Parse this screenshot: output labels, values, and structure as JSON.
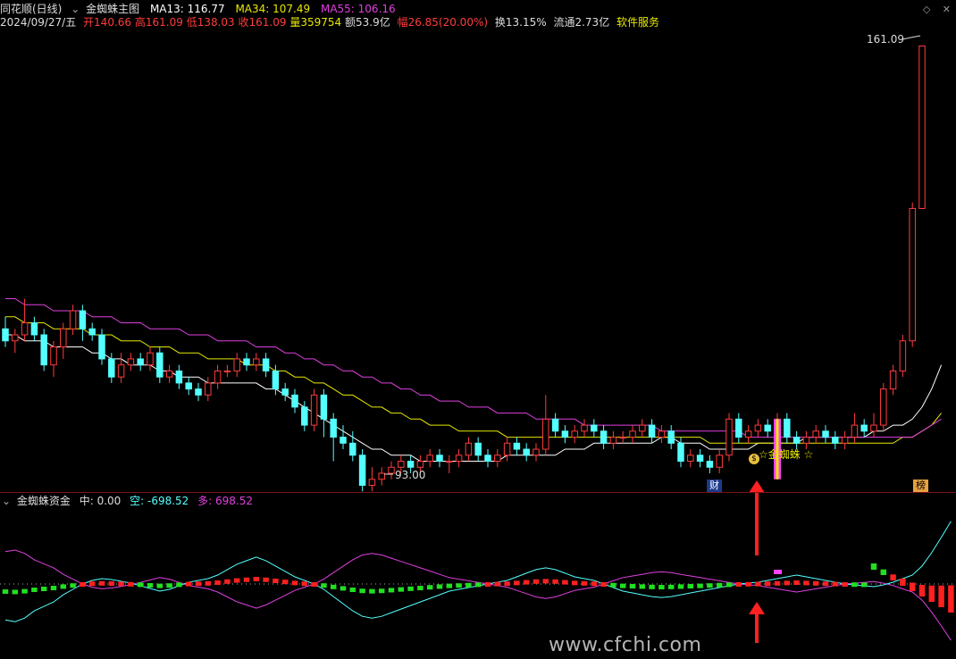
{
  "header": {
    "app": "同花顺(日线)",
    "indicator": "金蜘蛛主图",
    "ma13": "MA13: 116.77",
    "ma34": "MA34: 107.49",
    "ma55": "MA55: 106.16",
    "date": "2024/09/27/五",
    "open": "开140.66",
    "high": "高161.09",
    "low": "低138.03",
    "close": "收161.09",
    "volume": "量359754",
    "amount": "额53.9亿",
    "change": "幅26.85(20.00%)",
    "turnover": "换13.15%",
    "float": "流通2.73亿",
    "sector": "软件服务"
  },
  "subpanel": {
    "title": "金蜘蛛资金",
    "mid": "中: 0.00",
    "short": "空: -698.52",
    "long": "多: 698.52"
  },
  "labels": {
    "high_price": "161.09",
    "low_price": "93.00",
    "signal": "☆金蜘蛛 ☆",
    "signal_badge": "$",
    "marker_cai": "财",
    "marker_bang": "榜"
  },
  "watermark": "www.cfchi.com",
  "colors": {
    "up": "#ff3c3c",
    "down": "#54ffff",
    "ma13": "#ffffff",
    "ma34": "#e8e800",
    "ma55": "#e040e0",
    "arrow": "#ff2020",
    "grid": "#7a1414"
  },
  "chart_data": {
    "type": "candlestick",
    "price_range": [
      90,
      163
    ],
    "candles": [
      [
        114,
        112,
        116,
        111
      ],
      [
        112,
        113,
        114,
        110
      ],
      [
        113,
        115,
        119,
        112
      ],
      [
        115,
        113,
        116,
        112
      ],
      [
        113,
        108,
        114,
        107
      ],
      [
        108,
        111,
        112,
        106
      ],
      [
        111,
        114,
        115,
        109
      ],
      [
        114,
        117,
        118,
        113
      ],
      [
        117,
        114,
        118,
        112
      ],
      [
        114,
        113,
        115,
        112
      ],
      [
        113,
        109,
        114,
        108
      ],
      [
        109,
        106,
        110,
        105
      ],
      [
        106,
        108,
        110,
        105
      ],
      [
        108,
        109,
        110,
        107
      ],
      [
        109,
        108,
        110,
        107
      ],
      [
        108,
        110,
        111,
        107
      ],
      [
        110,
        106,
        111,
        105
      ],
      [
        106,
        107,
        108,
        105
      ],
      [
        107,
        105,
        108,
        104
      ],
      [
        105,
        104,
        106,
        103
      ],
      [
        104,
        103,
        105,
        102
      ],
      [
        103,
        105,
        106,
        102
      ],
      [
        105,
        107,
        108,
        104
      ],
      [
        107,
        107,
        108,
        106
      ],
      [
        107,
        109,
        110,
        106
      ],
      [
        109,
        108,
        110,
        107
      ],
      [
        108,
        109,
        110,
        107
      ],
      [
        109,
        107,
        110,
        106
      ],
      [
        107,
        104,
        108,
        103
      ],
      [
        104,
        103,
        105,
        102
      ],
      [
        103,
        101,
        104,
        100
      ],
      [
        101,
        98,
        102,
        97
      ],
      [
        98,
        103,
        104,
        97
      ],
      [
        103,
        99,
        104,
        96
      ],
      [
        99,
        96,
        100,
        92
      ],
      [
        96,
        95,
        98,
        94
      ],
      [
        95,
        93,
        97,
        92
      ],
      [
        93,
        88,
        94,
        87
      ],
      [
        88,
        89,
        91,
        87
      ],
      [
        89,
        90,
        91,
        88
      ],
      [
        90,
        91,
        92,
        89
      ],
      [
        91,
        92,
        93,
        90
      ],
      [
        92,
        91,
        93,
        90
      ],
      [
        91,
        92,
        93,
        90
      ],
      [
        92,
        93,
        94,
        91
      ],
      [
        93,
        92,
        94,
        91
      ],
      [
        92,
        92,
        93,
        90
      ],
      [
        92,
        93,
        94,
        91
      ],
      [
        93,
        95,
        96,
        92
      ],
      [
        95,
        93,
        96,
        92
      ],
      [
        93,
        92,
        94,
        91
      ],
      [
        92,
        93,
        94,
        91
      ],
      [
        93,
        95,
        96,
        92
      ],
      [
        95,
        94,
        96,
        93
      ],
      [
        94,
        93,
        95,
        92
      ],
      [
        93,
        94,
        95,
        92
      ],
      [
        94,
        99,
        103,
        93
      ],
      [
        99,
        97,
        100,
        96
      ],
      [
        97,
        96,
        98,
        95
      ],
      [
        96,
        97,
        98,
        95
      ],
      [
        97,
        98,
        99,
        96
      ],
      [
        98,
        97,
        99,
        96
      ],
      [
        97,
        95,
        98,
        94
      ],
      [
        95,
        96,
        97,
        94
      ],
      [
        96,
        96,
        97,
        95
      ],
      [
        96,
        97,
        98,
        95
      ],
      [
        97,
        98,
        99,
        96
      ],
      [
        98,
        96,
        99,
        95
      ],
      [
        96,
        97,
        98,
        95
      ],
      [
        97,
        95,
        98,
        94
      ],
      [
        95,
        92,
        96,
        91
      ],
      [
        92,
        93,
        94,
        91
      ],
      [
        93,
        92,
        94,
        91
      ],
      [
        92,
        91,
        93,
        90
      ],
      [
        91,
        93,
        94,
        90
      ],
      [
        93,
        99,
        100,
        92
      ],
      [
        99,
        96,
        100,
        95
      ],
      [
        96,
        97,
        98,
        95
      ],
      [
        97,
        98,
        99,
        96
      ],
      [
        98,
        97,
        99,
        96
      ],
      [
        97,
        99,
        100,
        96
      ],
      [
        99,
        96,
        100,
        95
      ],
      [
        96,
        95,
        97,
        94
      ],
      [
        95,
        96,
        97,
        94
      ],
      [
        96,
        97,
        98,
        95
      ],
      [
        97,
        96,
        98,
        95
      ],
      [
        96,
        95,
        97,
        94
      ],
      [
        95,
        96,
        97,
        94
      ],
      [
        96,
        98,
        100,
        95
      ],
      [
        98,
        97,
        99,
        96
      ],
      [
        97,
        98,
        100,
        96
      ],
      [
        98,
        104,
        105,
        97
      ],
      [
        104,
        107,
        108,
        103
      ],
      [
        107,
        112,
        113,
        106
      ],
      [
        112,
        134,
        135,
        111
      ],
      [
        134,
        161,
        161,
        138
      ]
    ],
    "ma13": [
      113,
      113,
      112,
      112,
      112,
      111,
      111,
      111,
      111,
      110,
      110,
      109,
      109,
      108,
      108,
      108,
      107,
      107,
      106,
      106,
      106,
      105,
      105,
      105,
      105,
      105,
      105,
      104,
      104,
      103,
      102,
      101,
      100,
      99,
      98,
      97,
      96,
      95,
      94,
      94,
      93,
      93,
      93,
      92,
      92,
      92,
      92,
      92,
      92,
      92,
      92,
      92,
      93,
      93,
      93,
      93,
      93,
      93,
      94,
      94,
      94,
      95,
      95,
      95,
      95,
      95,
      95,
      95,
      96,
      96,
      95,
      95,
      95,
      94,
      94,
      94,
      94,
      94,
      95,
      95,
      95,
      95,
      95,
      96,
      96,
      96,
      96,
      96,
      96,
      96,
      97,
      97,
      98,
      98,
      99,
      101,
      104,
      108
    ],
    "ma34": [
      116,
      116,
      115,
      115,
      115,
      114,
      114,
      114,
      114,
      113,
      113,
      113,
      112,
      112,
      112,
      111,
      111,
      111,
      110,
      110,
      110,
      109,
      109,
      109,
      109,
      108,
      108,
      108,
      107,
      107,
      106,
      106,
      105,
      105,
      104,
      103,
      103,
      102,
      101,
      101,
      100,
      100,
      99,
      99,
      98,
      98,
      98,
      97,
      97,
      97,
      97,
      97,
      96,
      96,
      96,
      96,
      96,
      96,
      96,
      96,
      96,
      96,
      96,
      96,
      96,
      96,
      96,
      96,
      96,
      96,
      96,
      96,
      96,
      95,
      95,
      95,
      95,
      95,
      95,
      95,
      95,
      95,
      95,
      95,
      95,
      95,
      95,
      95,
      95,
      95,
      95,
      95,
      95,
      96,
      96,
      97,
      98,
      100
    ],
    "ma55": [
      119,
      119,
      118,
      118,
      118,
      117,
      117,
      117,
      117,
      116,
      116,
      116,
      115,
      115,
      115,
      114,
      114,
      114,
      114,
      113,
      113,
      113,
      112,
      112,
      112,
      112,
      111,
      111,
      111,
      110,
      110,
      109,
      109,
      108,
      108,
      107,
      107,
      106,
      106,
      105,
      105,
      104,
      104,
      103,
      103,
      102,
      102,
      102,
      101,
      101,
      101,
      100,
      100,
      100,
      100,
      99,
      99,
      99,
      99,
      99,
      98,
      98,
      98,
      98,
      98,
      98,
      98,
      98,
      97,
      97,
      97,
      97,
      97,
      97,
      97,
      97,
      97,
      96,
      96,
      96,
      96,
      96,
      96,
      96,
      96,
      96,
      96,
      96,
      96,
      96,
      96,
      96,
      96,
      96,
      96,
      97,
      98,
      99
    ],
    "funds": [
      -400,
      -420,
      -380,
      -300,
      -250,
      -200,
      -120,
      -60,
      0,
      40,
      60,
      50,
      30,
      10,
      -20,
      -50,
      -80,
      -60,
      -20,
      20,
      40,
      60,
      100,
      160,
      220,
      260,
      300,
      260,
      200,
      140,
      80,
      40,
      0,
      -60,
      -140,
      -220,
      -300,
      -360,
      -380,
      -360,
      -320,
      -280,
      -240,
      -200,
      -160,
      -120,
      -80,
      -60,
      -40,
      -20,
      0,
      20,
      40,
      80,
      120,
      160,
      180,
      160,
      120,
      80,
      60,
      40,
      0,
      -40,
      -80,
      -100,
      -120,
      -140,
      -150,
      -140,
      -120,
      -100,
      -80,
      -60,
      -40,
      -20,
      0,
      10,
      20,
      40,
      60,
      80,
      100,
      80,
      60,
      40,
      20,
      0,
      -10,
      -20,
      -30,
      -10,
      20,
      60,
      100,
      200,
      350,
      520,
      698.52
    ],
    "funds_range": [
      -700,
      700
    ]
  }
}
